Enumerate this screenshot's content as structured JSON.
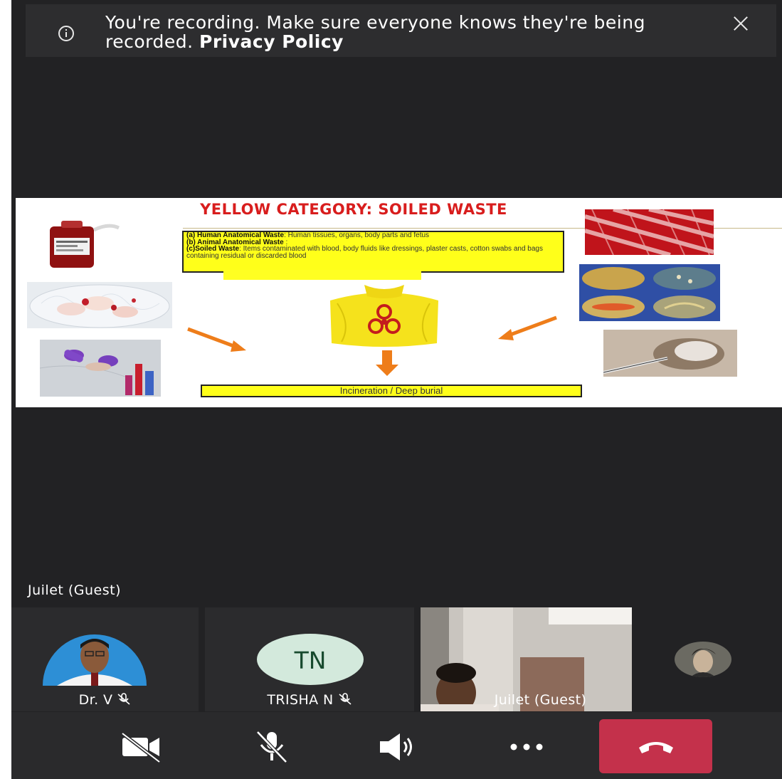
{
  "banner": {
    "message": "You're recording. Make sure everyone knows they're being recorded.",
    "link": "Privacy Policy"
  },
  "slide": {
    "title": "YELLOW CATEGORY: SOILED WASTE",
    "items": [
      {
        "label": "(a) Human Anatomical Waste",
        "text": ": Human tissues, organs, body parts and fetus"
      },
      {
        "label": "(b) Animal Anatomical Waste",
        "text": " :"
      },
      {
        "label": "(c)Soiled Waste",
        "text": ": Items contaminated with blood, body fluids like dressings, plaster casts, cotton swabs and bags containing residual or discarded blood"
      }
    ],
    "disposal": "Incineration / Deep burial"
  },
  "active_speaker": "Juilet (Guest)",
  "participants": [
    {
      "name": "Dr. V",
      "muted": true
    },
    {
      "name": "TRISHA N",
      "initials": "TN",
      "muted": true
    },
    {
      "name": "Juilet (Guest)",
      "video": true
    }
  ],
  "colors": {
    "background": "#222224",
    "hangup": "#c4314b",
    "slide_title": "#d81d1d",
    "highlight": "#ffff1a",
    "arrow": "#ee7d1a"
  },
  "controls": [
    "camera-off-icon",
    "mic-off-icon",
    "speaker-icon",
    "more-icon",
    "hangup-icon"
  ]
}
